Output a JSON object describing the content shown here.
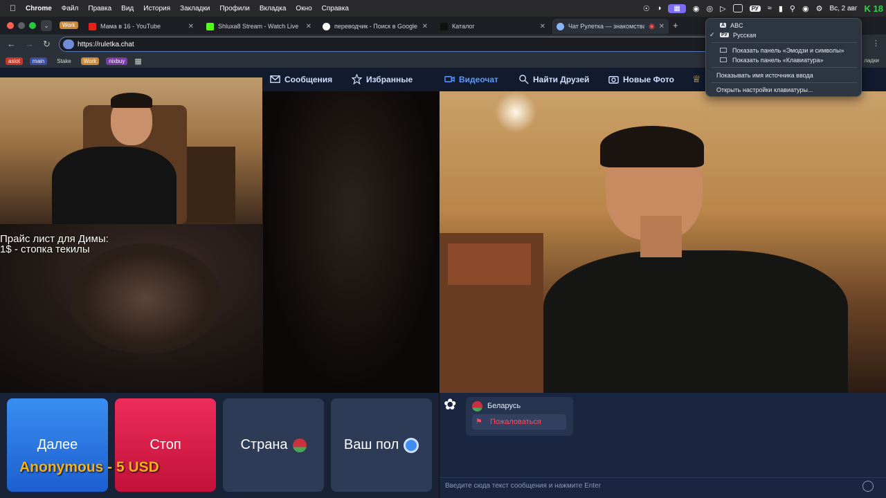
{
  "menubar": {
    "app": "Chrome",
    "items": [
      "Файл",
      "Правка",
      "Вид",
      "История",
      "Закладки",
      "Профили",
      "Вкладка",
      "Окно",
      "Справка"
    ],
    "input_source": "РУ",
    "datetime": "Вс, 2 авг",
    "badge": "K 18"
  },
  "tabs": [
    {
      "label": "Work",
      "type": "group"
    },
    {
      "label": "Мама в 16 - YouTube"
    },
    {
      "label": "Shluxa8 Stream - Watch Live"
    },
    {
      "label": "переводчик - Поиск в Google"
    },
    {
      "label": "Каталог"
    },
    {
      "label": "Чат Рулетка — знакомства"
    }
  ],
  "address": {
    "url": "https://ruletka.chat"
  },
  "bookmarks": [
    {
      "label": "aslot",
      "color": "#c0392b"
    },
    {
      "label": "main",
      "color": "#3a4ea6"
    },
    {
      "label": "Stake",
      "color": "transparent"
    },
    {
      "label": "Work",
      "color": "#c98a3b"
    },
    {
      "label": "nixbuy",
      "color": "#7b3aa6"
    }
  ],
  "bookmarks_right": "ладки",
  "sitenav": {
    "items": [
      {
        "label": "Сообщения",
        "icon": "mail-icon"
      },
      {
        "label": "Избранные",
        "icon": "star-icon"
      },
      {
        "label": "Видеочат",
        "icon": "video-icon",
        "active": true
      },
      {
        "label": "Найти Друзей",
        "icon": "search-icon"
      },
      {
        "label": "Новые Фото",
        "icon": "camera-icon"
      }
    ]
  },
  "overlay": {
    "line1": "Прайс лист для Димы:",
    "line2": "1$ - стопка текилы"
  },
  "controls": {
    "next": "Далее",
    "stop": "Стоп",
    "country": "Страна",
    "gender": "Ваш пол"
  },
  "donation": "Anonymous - 5 USD",
  "chat": {
    "country": "Беларусь",
    "report": "Пожаловаться",
    "input_placeholder": "Введите сюда текст сообщения и нажмите Enter"
  },
  "dropdown": {
    "sources": [
      {
        "badge": "A",
        "label": "ABC",
        "checked": false
      },
      {
        "badge": "РУ",
        "label": "Русская",
        "checked": true
      }
    ],
    "panels": [
      "Показать панель «Эмодзи и символы»",
      "Показать панель «Клавиатура»"
    ],
    "show_name": "Показывать имя источника ввода",
    "open_settings": "Открыть настройки клавиатуры..."
  }
}
